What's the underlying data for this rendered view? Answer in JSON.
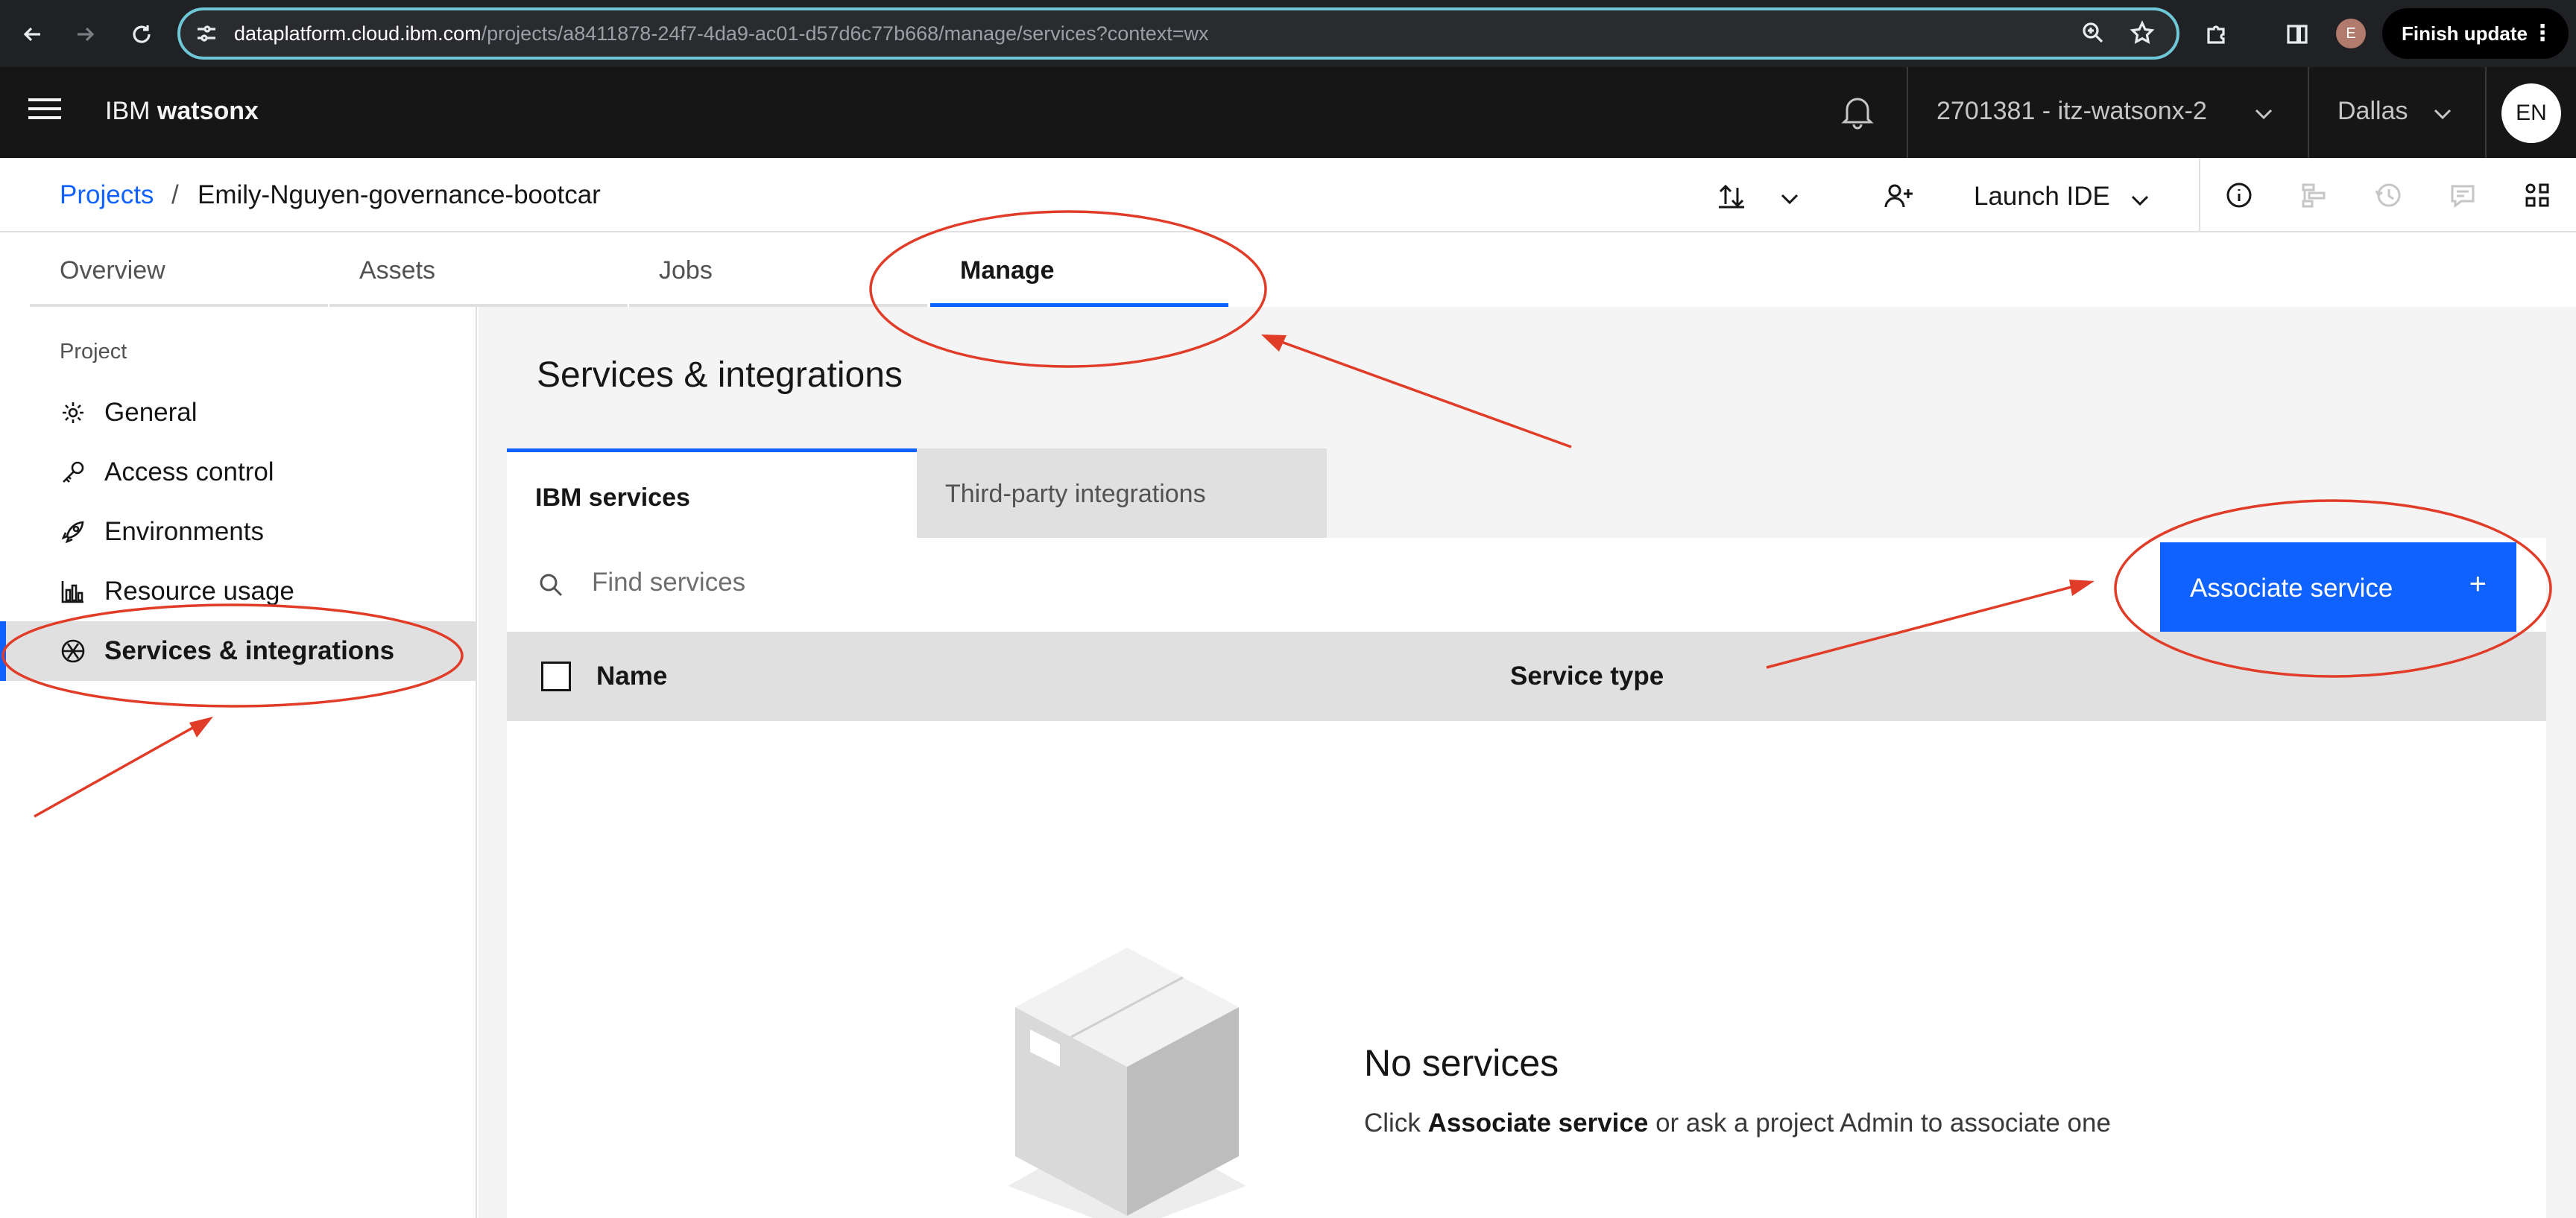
{
  "browser": {
    "url_host": "dataplatform.cloud.ibm.com",
    "url_path": "/projects/a8411878-24f7-4da9-ac01-d57d6c77b668/manage/services?context=wx",
    "profile_initial": "E",
    "finish_update_label": "Finish update"
  },
  "header": {
    "brand_prefix": "IBM",
    "brand_name": "watsonx",
    "account": "2701381 - itz-watsonx-2",
    "region": "Dallas",
    "avatar_initials": "EN"
  },
  "breadcrumb": {
    "parent": "Projects",
    "separator": "/",
    "current": "Emily-Nguyen-governance-bootcar"
  },
  "toolbar": {
    "launch_ide_label": "Launch IDE"
  },
  "tabs": [
    {
      "label": "Overview"
    },
    {
      "label": "Assets"
    },
    {
      "label": "Jobs"
    },
    {
      "label": "Manage"
    }
  ],
  "leftnav": {
    "heading": "Project",
    "items": [
      {
        "label": "General",
        "icon": "gear-icon"
      },
      {
        "label": "Access control",
        "icon": "key-icon"
      },
      {
        "label": "Environments",
        "icon": "rocket-icon"
      },
      {
        "label": "Resource usage",
        "icon": "bar-chart-icon"
      },
      {
        "label": "Services & integrations",
        "icon": "services-icon"
      }
    ]
  },
  "main": {
    "title": "Services & integrations",
    "subtabs": [
      {
        "label": "IBM services"
      },
      {
        "label": "Third-party integrations"
      }
    ],
    "search_placeholder": "Find services",
    "associate_button_label": "Associate service",
    "associate_button_icon": "+",
    "columns": [
      "Name",
      "Service type"
    ],
    "empty_title": "No services",
    "empty_desc_prefix": "Click",
    "empty_desc_bold": "Associate service",
    "empty_desc_suffix": "or ask a project Admin to associate one"
  },
  "colors": {
    "accent": "#0f62fe",
    "annotation": "#e03c28",
    "header_bg": "#161616"
  }
}
